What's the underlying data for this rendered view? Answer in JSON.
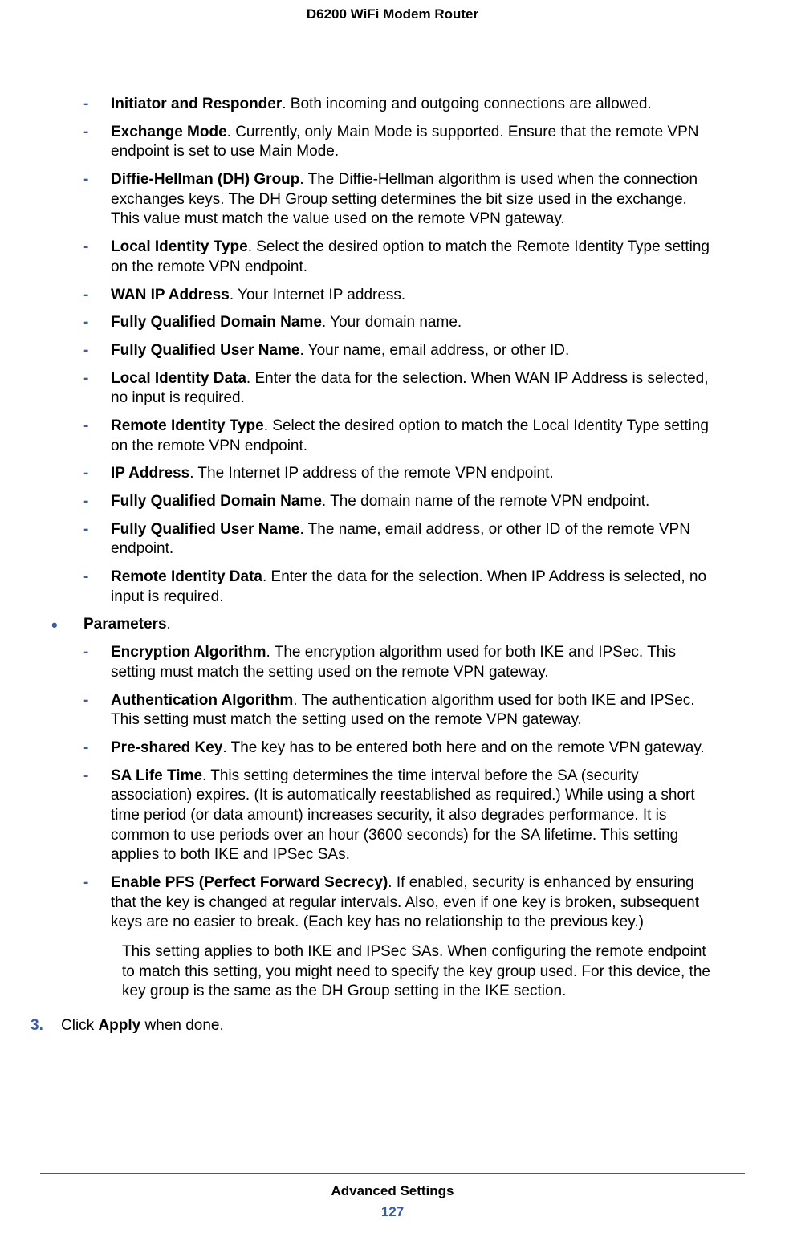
{
  "header": {
    "title": "D6200 WiFi Modem Router"
  },
  "items1": [
    {
      "term": "Initiator and Responder",
      "desc": ". Both incoming and outgoing connections are allowed."
    },
    {
      "term": "Exchange Mode",
      "desc": ". Currently, only Main Mode is supported. Ensure that the remote VPN endpoint is set to use Main Mode."
    },
    {
      "term": "Diffie-Hellman (DH) Group",
      "desc": ". The Diffie-Hellman algorithm is used when the connection exchanges keys. The DH Group setting determines the bit size used in the exchange. This value must match the value used on the remote VPN gateway."
    },
    {
      "term": "Local Identity Type",
      "desc": ". Select the desired option to match the Remote Identity Type setting on the remote VPN endpoint."
    },
    {
      "term": "WAN IP Address",
      "desc": ". Your Internet IP address."
    },
    {
      "term": "Fully Qualified Domain Name",
      "desc": ". Your domain name."
    },
    {
      "term": "Fully Qualified User Name",
      "desc": ". Your name, email address, or other ID."
    },
    {
      "term": "Local Identity Data",
      "desc": ". Enter the data for the selection. When WAN IP Address is selected, no input is required."
    },
    {
      "term": "Remote Identity Type",
      "desc": ". Select the desired option to match the Local Identity Type setting on the remote VPN endpoint."
    },
    {
      "term": "IP Address",
      "desc": ". The Internet IP address of the remote VPN endpoint."
    },
    {
      "term": "Fully Qualified Domain Name",
      "desc": ". The domain name of the remote VPN endpoint."
    },
    {
      "term": "Fully Qualified User Name",
      "desc": ". The name, email address, or other ID of the remote VPN endpoint."
    },
    {
      "term": "Remote Identity Data",
      "desc": ". Enter the data for the selection. When IP Address is selected, no input is required."
    }
  ],
  "section": {
    "label": "Parameters",
    "suffix": "."
  },
  "items2": [
    {
      "term": "Encryption Algorithm",
      "desc": ". The encryption algorithm used for both IKE and IPSec. This setting must match the setting used on the remote VPN gateway."
    },
    {
      "term": "Authentication Algorithm",
      "desc": ". The authentication algorithm used for both IKE and IPSec. This setting must match the setting used on the remote VPN gateway."
    },
    {
      "term": "Pre-shared Key",
      "desc": ". The key has to be entered both here and on the remote VPN gateway."
    },
    {
      "term": "SA Life Time",
      "desc": ". This setting determines the time interval before the SA (security association) expires. (It is automatically reestablished as required.) While using a short time period (or data amount) increases security, it also degrades performance. It is common to use periods over an hour (3600 seconds) for the SA lifetime. This setting applies to both IKE and IPSec SAs."
    },
    {
      "term": "Enable PFS (Perfect Forward Secrecy)",
      "desc": ". If enabled, security is enhanced by ensuring that the key is changed at regular intervals. Also, even if one key is broken, subsequent keys are no easier to break. (Each key has no relationship to the previous key.)"
    }
  ],
  "note": "This setting applies to both IKE and IPSec SAs. When configuring the remote endpoint to match this setting, you might need to specify the key group used. For this device, the key group is the same as the DH Group setting in the IKE section.",
  "step": {
    "num": "3.",
    "prefix": "Click ",
    "bold": "Apply",
    "suffix": " when done."
  },
  "footer": {
    "title": "Advanced Settings",
    "page": "127"
  }
}
